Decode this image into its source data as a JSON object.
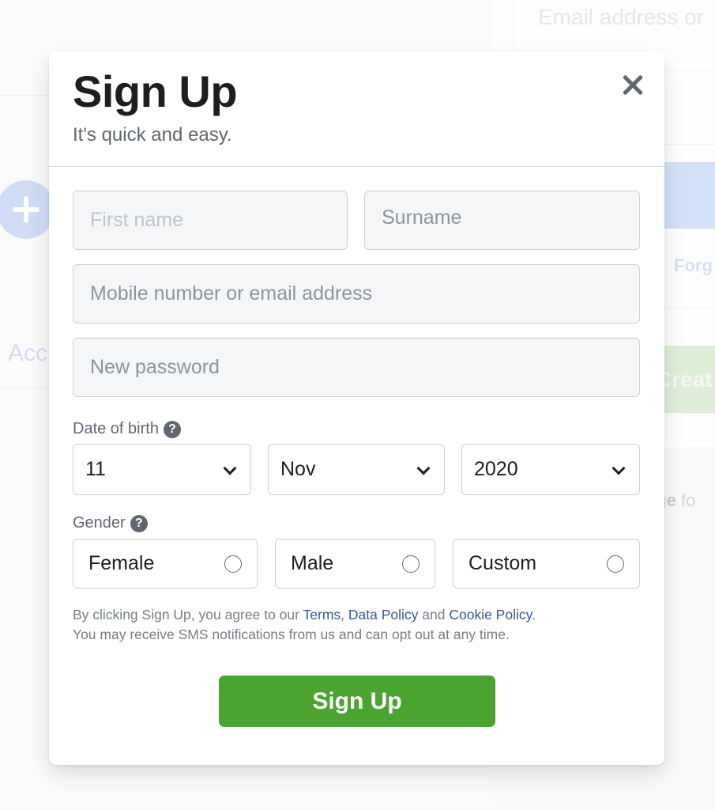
{
  "background": {
    "email_placeholder": "Email address or",
    "forgot_text": "Forg",
    "create_text": "Creat",
    "page_text_bold": "age",
    "page_text": " fo",
    "account_text": "Acc"
  },
  "modal": {
    "title": "Sign Up",
    "subtitle": "It's quick and easy.",
    "close_icon": "close-icon"
  },
  "form": {
    "first_name": {
      "placeholder": "First name",
      "value": ""
    },
    "surname": {
      "placeholder": "Surname",
      "value": ""
    },
    "contact": {
      "placeholder": "Mobile number or email address",
      "value": ""
    },
    "password": {
      "placeholder": "New password",
      "value": ""
    },
    "dob": {
      "label": "Date of birth",
      "help_icon": "?",
      "day": "11",
      "month": "Nov",
      "year": "2020"
    },
    "gender": {
      "label": "Gender",
      "help_icon": "?",
      "options": [
        {
          "label": "Female",
          "selected": false
        },
        {
          "label": "Male",
          "selected": false
        },
        {
          "label": "Custom",
          "selected": false
        }
      ]
    }
  },
  "terms": {
    "prefix": "By clicking Sign Up, you agree to our ",
    "terms_link": "Terms",
    "comma": ", ",
    "data_policy_link": "Data Policy",
    "and": " and ",
    "cookie_policy_link": "Cookie Policy",
    "period": ".",
    "line2": "You may receive SMS notifications from us and can opt out at any time."
  },
  "submit_label": "Sign Up",
  "colors": {
    "primary_green": "#4ba42f",
    "link": "#385898",
    "text_dark": "#1c1e21",
    "text_muted": "#606770"
  }
}
